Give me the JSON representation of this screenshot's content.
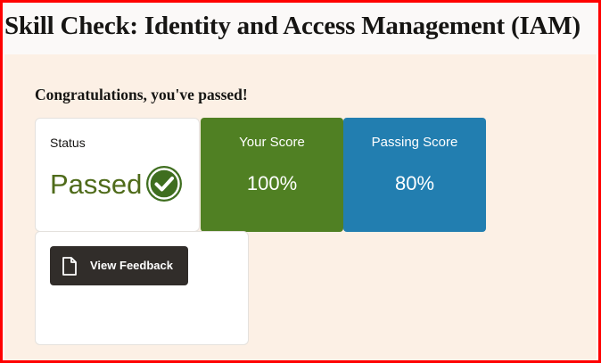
{
  "page": {
    "title": "Skill Check: Identity and Access Management (IAM)"
  },
  "result": {
    "message": "Congratulations, you've passed!"
  },
  "status_card": {
    "label": "Status",
    "value": "Passed",
    "icon": "check-circle-icon"
  },
  "score_card": {
    "label": "Your Score",
    "value": "100%",
    "color": "#508023"
  },
  "passing_card": {
    "label": "Passing Score",
    "value": "80%",
    "color": "#227eb0"
  },
  "feedback": {
    "button_label": "View Feedback",
    "icon": "document-icon"
  },
  "colors": {
    "frame_border": "#ff0000",
    "content_background": "#fcf0e5",
    "status_green": "#4f6b1a",
    "button_dark": "#312d2a"
  }
}
